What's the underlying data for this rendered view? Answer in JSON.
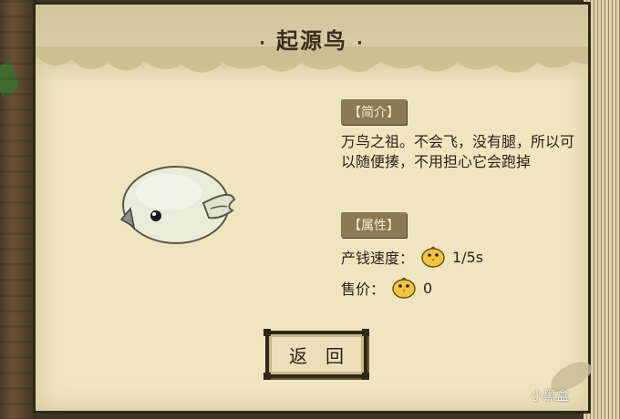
{
  "panel": {
    "title": "起源鸟",
    "title_dot_left": "·",
    "title_dot_right": "·"
  },
  "intro": {
    "tag": "【简介】",
    "text": "万鸟之祖。不会飞，没有腿，所以可以随便揍，不用担心它会跑掉"
  },
  "attributes": {
    "tag": "【属性】",
    "rows": [
      {
        "label": "产钱速度：",
        "icon": "chick-icon",
        "value": "1/5s"
      },
      {
        "label": "售价：",
        "icon": "chick-icon",
        "value": "0"
      }
    ]
  },
  "button": {
    "label": "返回"
  },
  "watermark": "小黑盒",
  "colors": {
    "paper": "#efe6bf",
    "tag_bg": "#8b7a52",
    "frame": "#2e2818",
    "chick": "#f2c53d"
  }
}
